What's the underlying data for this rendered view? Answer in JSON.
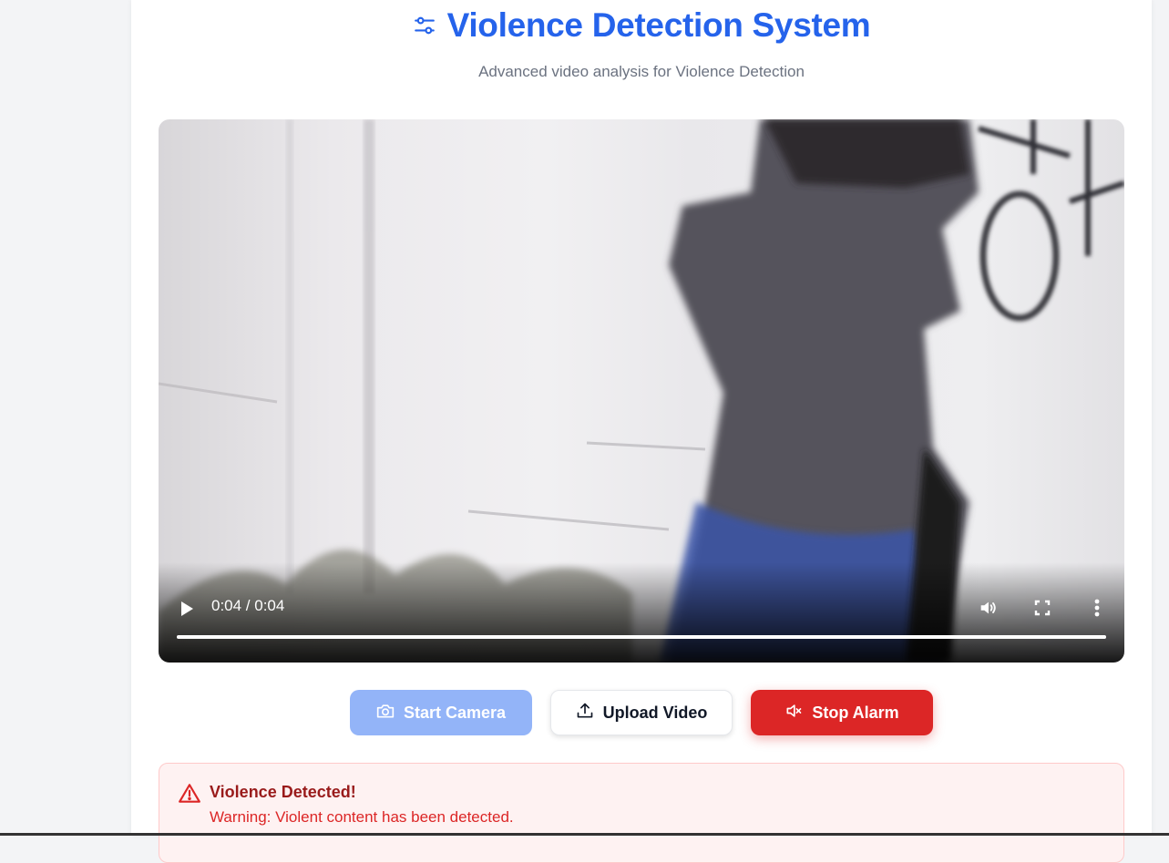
{
  "header": {
    "title": "Violence Detection System",
    "subtitle": "Advanced video analysis for Violence Detection",
    "icon": "sliders-icon",
    "accent_color": "#2563eb"
  },
  "video": {
    "time_display": "0:04 / 0:04",
    "progress": 1.0,
    "controls": [
      "play-icon",
      "volume-icon",
      "fullscreen-icon",
      "more-vertical-icon"
    ]
  },
  "actions": {
    "start_camera": {
      "label": "Start Camera",
      "icon": "camera-icon",
      "state": "disabled"
    },
    "upload_video": {
      "label": "Upload Video",
      "icon": "upload-icon"
    },
    "stop_alarm": {
      "label": "Stop Alarm",
      "icon": "volume-x-icon",
      "color": "#dc2626"
    }
  },
  "alert": {
    "title": "Violence Detected!",
    "message": "Warning: Violent content has been detected.",
    "icon": "alert-triangle-icon",
    "color": "#dc2626"
  }
}
